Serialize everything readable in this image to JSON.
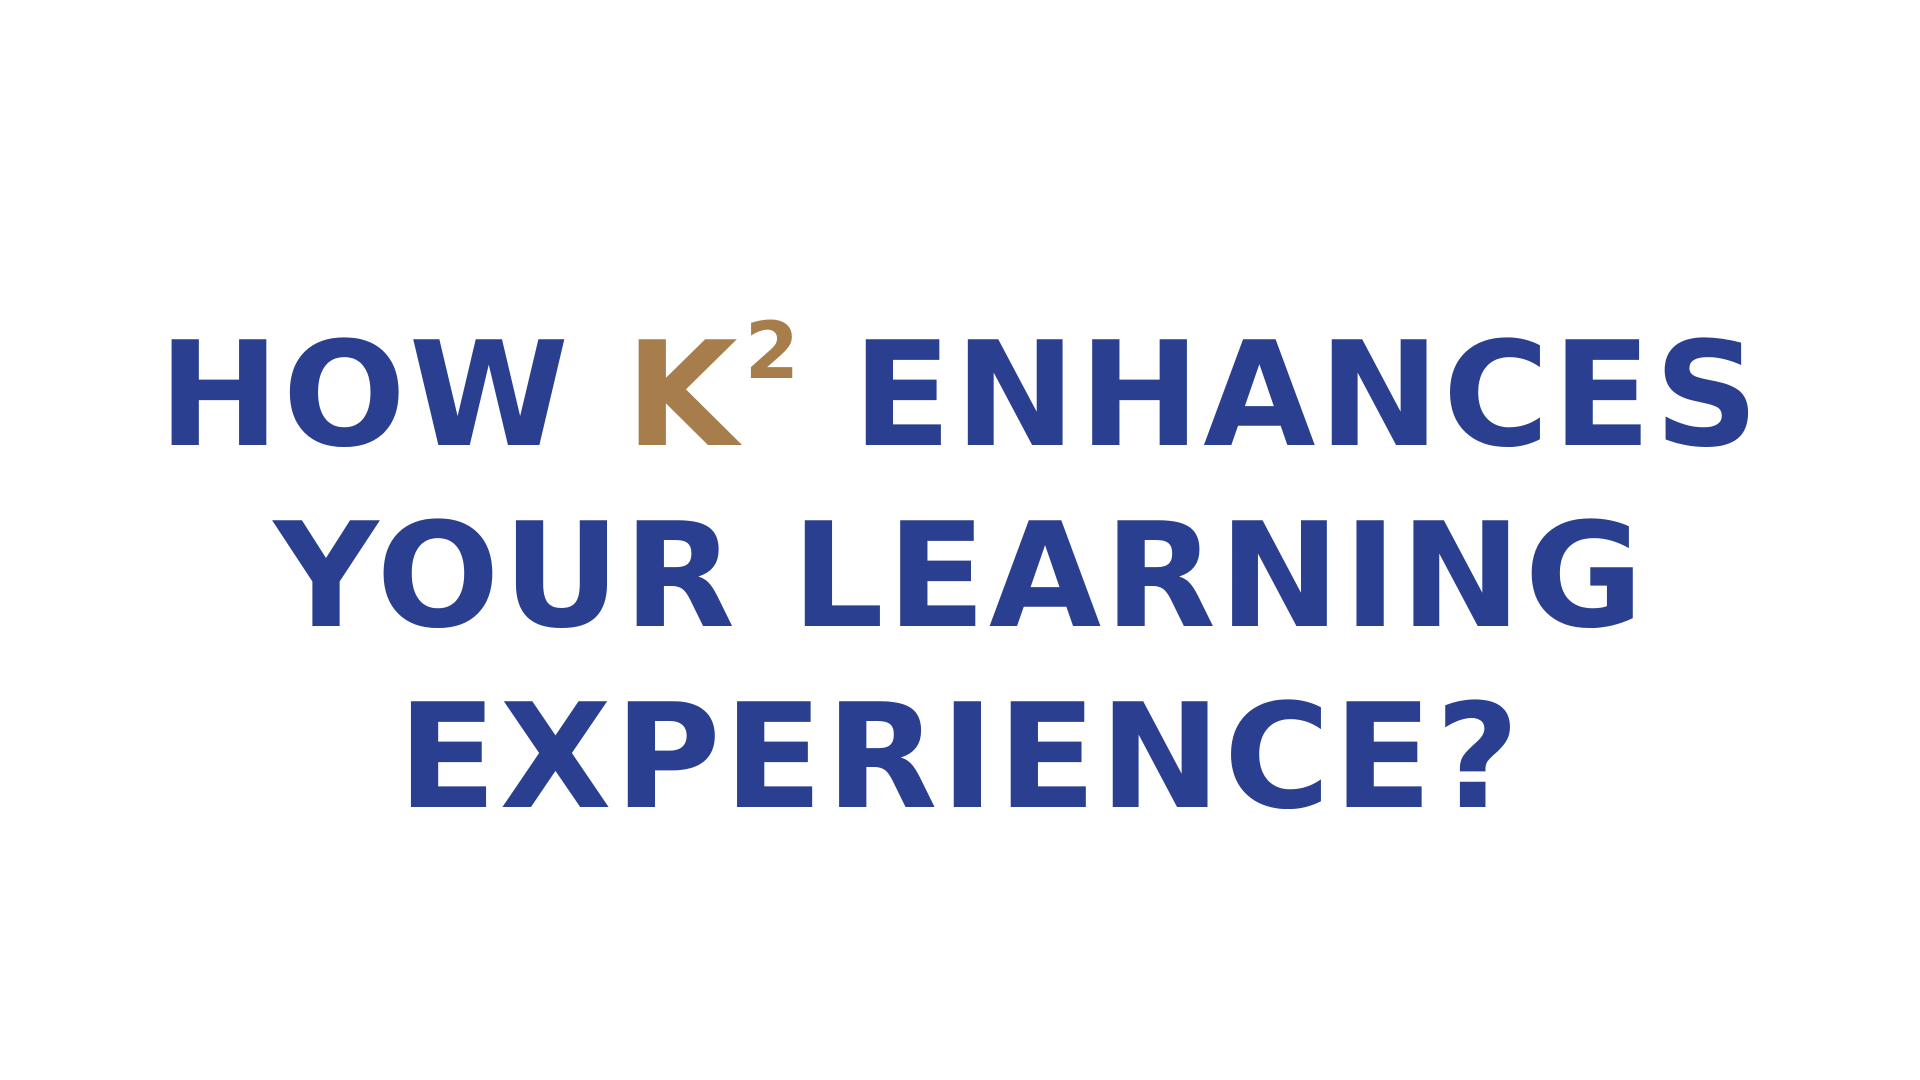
{
  "slide": {
    "headline": {
      "line1_before": "HOW",
      "brand_base": "K",
      "brand_sup": "2",
      "line1_after": "ENHANCES",
      "line2": "YOUR LEARNING",
      "line3": "EXPERIENCE?"
    },
    "colors": {
      "background": "#ffffff",
      "headline_text": "#2a3f8f",
      "brand_accent": "#a87d4c"
    }
  }
}
